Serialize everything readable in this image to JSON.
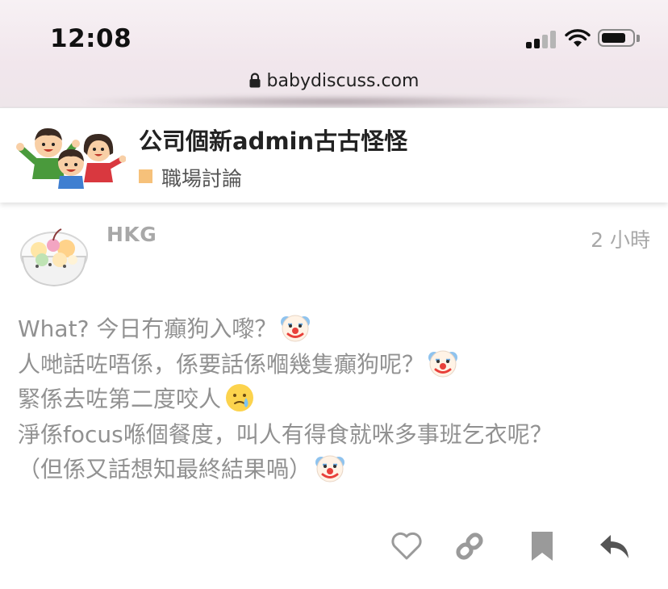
{
  "status_bar": {
    "time": "12:08"
  },
  "browser": {
    "url": "babydiscuss.com"
  },
  "topic": {
    "title": "公司個新admin古古怪怪",
    "category": "職場討論",
    "category_color": "#f6c17a"
  },
  "post": {
    "username": "HKG",
    "time_ago": "2 小時",
    "lines": [
      {
        "text": "What? 今日冇癲狗入嚟？",
        "emoji": "clown-face-icon"
      },
      {
        "text": "人哋話咗唔係，係要話係嗰幾隻癲狗呢？",
        "emoji": "clown-face-icon"
      },
      {
        "text": "緊係去咗第二度咬人",
        "emoji": "crying-face-icon"
      },
      {
        "text": "淨係focus喺個餐度，叫人有得食就咪多事班乞衣呢？",
        "emoji": ""
      },
      {
        "text": "（但係又話想知最終結果喎）",
        "emoji": "clown-face-icon"
      }
    ]
  },
  "actions": {
    "icons": [
      "heart-icon",
      "link-icon",
      "bookmark-icon",
      "reply-icon"
    ],
    "icon_color": "#9a9a9a",
    "reply_color": "#555555"
  }
}
